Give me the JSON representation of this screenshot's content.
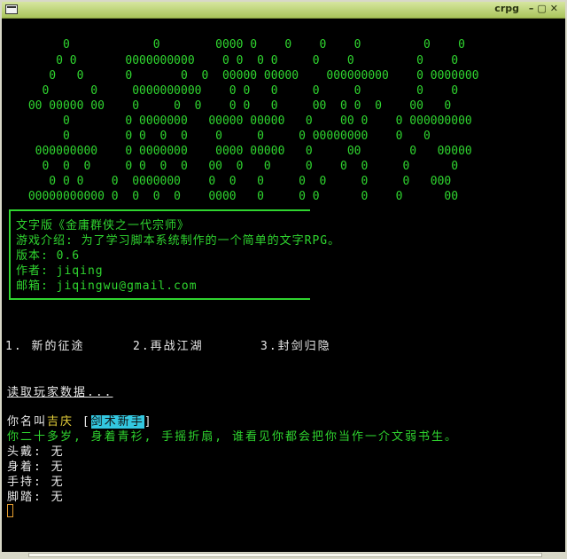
{
  "window": {
    "title": "crpg",
    "buttons": [
      "–",
      "▢",
      "✕"
    ]
  },
  "banner_lines": [
    "      0            0        0000 0    0    0    0         0    0",
    "     0 0       0000000000    0 0  0 0     0    0         0    0",
    "    0   0      0       0  0  00000 00000    000000000    0 0000000",
    "   0      0     0000000000    0 0   0     0     0        0    0",
    " 00 00000 00    0     0  0    0 0   0     00  0 0  0    00   0",
    "      0        0 0000000   00000 00000   0    00 0    0 000000000",
    "      0        0 0  0  0    0     0     0 00000000    0   0",
    "  000000000    0 0000000    0000 00000   0     00       0   00000",
    "   0  0  0     0 0  0  0   00  0   0     0    0  0     0      0",
    "    0 0 0    0  0000000    0  0   0     0  0     0     0   000",
    " 00000000000 0  0  0  0    0000   0     0 0      0    0      00"
  ],
  "intro": {
    "title": "文字版《金庸群侠之一代宗师》",
    "description": "游戏介绍: 为了学习脚本系统制作的一个简单的文字RPG。",
    "version": "版本: 0.6",
    "author": "作者: jiqing",
    "email": "邮箱: jiqingwu@gmail.com"
  },
  "menu": {
    "item1": "1. 新的征途",
    "item2": "2.再战江湖",
    "item3": "3.封剑归隐"
  },
  "loading_text": "读取玩家数据...",
  "player": {
    "name_prefix": "你名叫",
    "name": "吉庆",
    "bracket_open": "[",
    "title": "剑术新手",
    "bracket_close": "]",
    "description": "你二十多岁, 身着青衫, 手摇折扇, 谁看见你都会把你当作一介文弱书生。",
    "head": "头戴: 无",
    "body": "身着: 无",
    "hand": "手持: 无",
    "feet": "脚踏: 无"
  },
  "colors": {
    "terminal_bg": "#000000",
    "green": "#2fd52f",
    "yellow": "#e8d23a",
    "highlight": "#33c7e0"
  }
}
